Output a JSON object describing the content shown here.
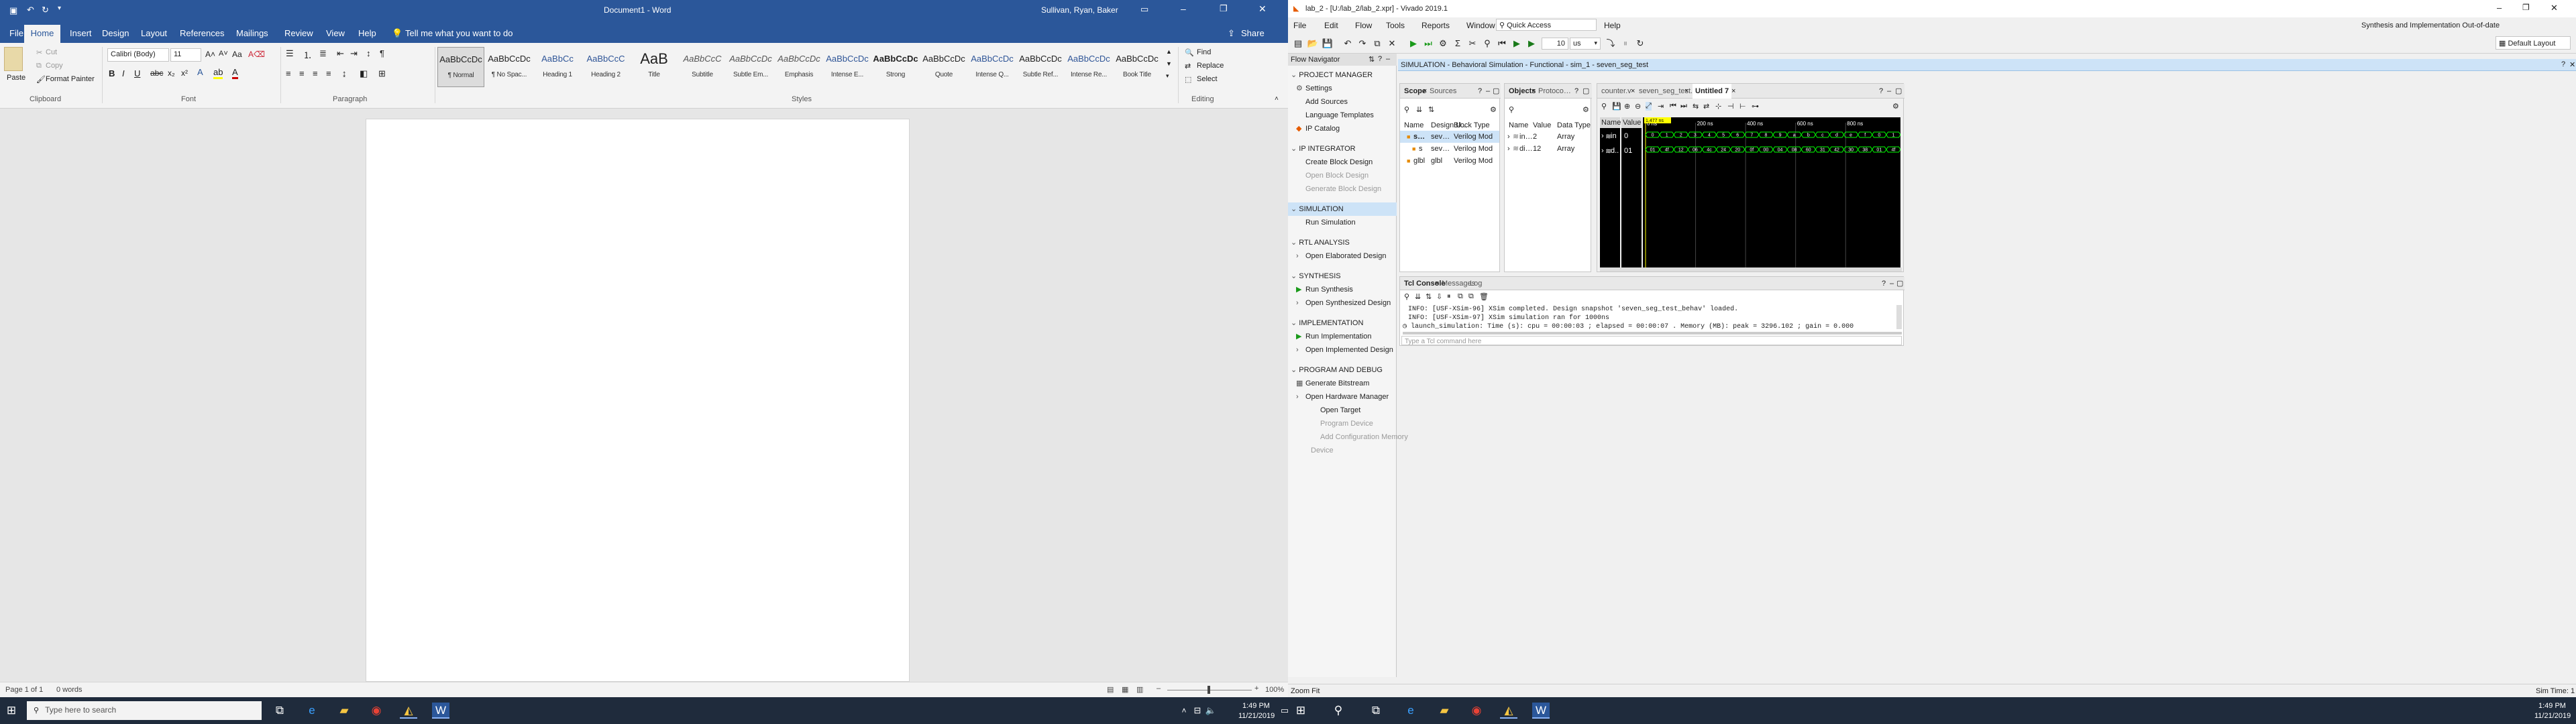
{
  "word": {
    "title": "Document1 - Word",
    "user": "Sullivan, Ryan, Baker",
    "file_tab": "File",
    "tabs": [
      "Home",
      "Insert",
      "Design",
      "Layout",
      "References",
      "Mailings",
      "Review",
      "View",
      "Help"
    ],
    "tell_me": "Tell me what you want to do",
    "share": "Share",
    "clipboard": {
      "paste": "Paste",
      "cut": "Cut",
      "copy": "Copy",
      "format_painter": "Format Painter",
      "label": "Clipboard"
    },
    "font": {
      "name": "Calibri (Body)",
      "size": "11",
      "label": "Font"
    },
    "paragraph_label": "Paragraph",
    "styles": [
      {
        "preview": "AaBbCcDc",
        "name": "¶ Normal"
      },
      {
        "preview": "AaBbCcDc",
        "name": "¶ No Spac..."
      },
      {
        "preview": "AaBbCc",
        "name": "Heading 1"
      },
      {
        "preview": "AaBbCcC",
        "name": "Heading 2"
      },
      {
        "preview": "AaB",
        "name": "Title"
      },
      {
        "preview": "AaBbCcC",
        "name": "Subtitle"
      },
      {
        "preview": "AaBbCcDc",
        "name": "Subtle Em..."
      },
      {
        "preview": "AaBbCcDc",
        "name": "Emphasis"
      },
      {
        "preview": "AaBbCcDc",
        "name": "Intense E..."
      },
      {
        "preview": "AaBbCcDc",
        "name": "Strong"
      },
      {
        "preview": "AaBbCcDc",
        "name": "Quote"
      },
      {
        "preview": "AaBbCcDc",
        "name": "Intense Q..."
      },
      {
        "preview": "AaBbCcDc",
        "name": "Subtle Ref..."
      },
      {
        "preview": "AaBbCcDc",
        "name": "Intense Re..."
      },
      {
        "preview": "AaBbCcDc",
        "name": "Book Title"
      }
    ],
    "styles_label": "Styles",
    "editing": {
      "find": "Find",
      "replace": "Replace",
      "select": "Select",
      "label": "Editing"
    },
    "status": {
      "page": "Page 1 of 1",
      "words": "0 words",
      "zoom": "100%"
    }
  },
  "vivado": {
    "title": "lab_2 - [U:/lab_2/lab_2.xpr] - Vivado 2019.1",
    "menus": [
      "File",
      "Edit",
      "Flow",
      "Tools",
      "Reports",
      "Window",
      "Layout",
      "View",
      "Run",
      "Help"
    ],
    "quick_access": "Quick Access",
    "status_right": "Synthesis and Implementation Out-of-date",
    "details": "details",
    "layout": "Default Layout",
    "run_time": "10",
    "run_unit": "us",
    "flow_nav_title": "Flow Navigator",
    "sim_header": "SIMULATION - Behavioral Simulation - Functional - sim_1 - seven_seg_test",
    "nav": [
      {
        "head": "PROJECT MANAGER",
        "items": [
          {
            "t": "Settings",
            "icon": "gear"
          },
          {
            "t": "Add Sources"
          },
          {
            "t": "Language Templates"
          },
          {
            "t": "IP Catalog",
            "icon": "ip"
          }
        ]
      },
      {
        "head": "IP INTEGRATOR",
        "items": [
          {
            "t": "Create Block Design"
          },
          {
            "t": "Open Block Design",
            "dis": true
          },
          {
            "t": "Generate Block Design",
            "dis": true
          }
        ]
      },
      {
        "head": "SIMULATION",
        "items": [
          {
            "t": "Run Simulation"
          }
        ]
      },
      {
        "head": "RTL ANALYSIS",
        "items": [
          {
            "t": "Open Elaborated Design",
            "exp": true
          }
        ]
      },
      {
        "head": "SYNTHESIS",
        "items": [
          {
            "t": "Run Synthesis",
            "icon": "play"
          },
          {
            "t": "Open Synthesized Design",
            "exp": true
          }
        ]
      },
      {
        "head": "IMPLEMENTATION",
        "items": [
          {
            "t": "Run Implementation",
            "icon": "play"
          },
          {
            "t": "Open Implemented Design",
            "exp": true
          }
        ]
      },
      {
        "head": "PROGRAM AND DEBUG",
        "items": [
          {
            "t": "Generate Bitstream",
            "icon": "bit"
          },
          {
            "t": "Open Hardware Manager",
            "exp": true
          },
          {
            "t": "Open Target",
            "sub": true
          },
          {
            "t": "Program Device",
            "sub": true,
            "dis": true
          },
          {
            "t": "Add Configuration Memory Device",
            "sub": true,
            "dis": true
          }
        ]
      }
    ],
    "scope": {
      "tabs": [
        "Scope",
        "Sources"
      ],
      "cols": [
        "Name",
        "Design U...",
        "Block Type"
      ],
      "rows": [
        {
          "name": "seven",
          "unit": "seven_s...",
          "type": "Verilog Mod",
          "sel": true
        },
        {
          "name": "s",
          "unit": "seven_segm",
          "type": "Verilog Mod",
          "indent": true
        },
        {
          "name": "glbl",
          "unit": "glbl",
          "type": "Verilog Mod"
        }
      ]
    },
    "objects": {
      "tabs": [
        "Objects",
        "Protocol Inst"
      ],
      "cols": [
        "Name",
        "Value",
        "Data Type"
      ],
      "rows": [
        {
          "name": "in[3:0]",
          "value": "2",
          "type": "Array"
        },
        {
          "name": "displa",
          "value": "12",
          "type": "Array"
        }
      ]
    },
    "wave": {
      "tabs": [
        "counter.v",
        "seven_seg_test.v",
        "Untitled 7"
      ],
      "cursor": "1,477 ns",
      "cols": [
        "Name",
        "Value"
      ],
      "signals": [
        {
          "name": "in",
          "value": "0"
        },
        {
          "name": "d..",
          "value": "01"
        }
      ],
      "time_labels": [
        "0 ns",
        "200 ns",
        "400 ns",
        "600 ns",
        "800 ns"
      ],
      "row1": [
        "0",
        "1",
        "2",
        "3",
        "4",
        "5",
        "6",
        "7",
        "8",
        "9",
        "a",
        "b",
        "c",
        "d",
        "e",
        "f",
        "0",
        "1"
      ],
      "row2": [
        "01",
        "4f",
        "12",
        "06",
        "4c",
        "24",
        "20",
        "0f",
        "00",
        "04",
        "08",
        "60",
        "31",
        "42",
        "30",
        "38",
        "01",
        "4f"
      ]
    },
    "tcl": {
      "tabs": [
        "Tcl Console",
        "Messages",
        "Log"
      ],
      "lines": [
        "INFO: [USF-XSim-96] XSim completed. Design snapshot 'seven_seg_test_behav' loaded.",
        "INFO: [USF-XSim-97] XSim simulation ran for 1000ns",
        "launch_simulation: Time (s): cpu = 00:00:03 ; elapsed = 00:00:07 . Memory (MB): peak = 3296.102 ; gain = 0.000"
      ],
      "placeholder": "Type a Tcl command here"
    },
    "status_left": "Zoom Fit",
    "status_sim": "Sim Time: 1 us"
  },
  "taskbar": {
    "search": "Type here to search",
    "time_left": "1:49 PM",
    "date_left": "11/21/2019",
    "time_right": "1:49 PM",
    "date_right": "11/21/2019"
  },
  "colors": {
    "word_blue": "#2b579a",
    "vivado_sel": "#cde3f7",
    "wave_green": "#00ff00",
    "cursor_yellow": "#ffff00"
  }
}
